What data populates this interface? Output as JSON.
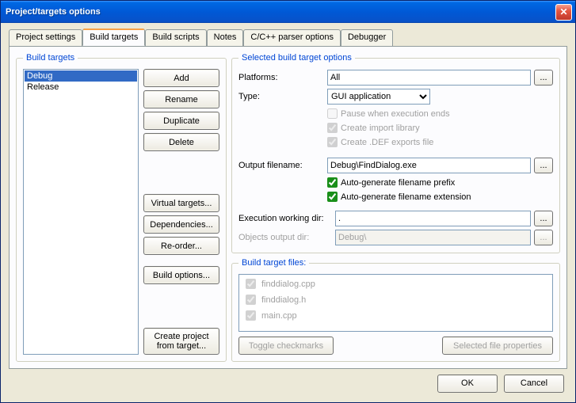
{
  "window": {
    "title": "Project/targets options"
  },
  "tabs": [
    "Project settings",
    "Build targets",
    "Build scripts",
    "Notes",
    "C/C++ parser options",
    "Debugger"
  ],
  "active_tab_index": 1,
  "build_targets": {
    "legend": "Build targets",
    "items": [
      "Debug",
      "Release"
    ],
    "selected_index": 0,
    "buttons": {
      "add": "Add",
      "rename": "Rename",
      "duplicate": "Duplicate",
      "delete": "Delete",
      "virtual": "Virtual targets...",
      "deps": "Dependencies...",
      "reorder": "Re-order...",
      "build_opts": "Build options...",
      "create_from": "Create project\nfrom target..."
    }
  },
  "selected_opts": {
    "legend": "Selected build target options",
    "platforms_label": "Platforms:",
    "platforms_value": "All",
    "type_label": "Type:",
    "type_value": "GUI application",
    "pause": "Pause when execution ends",
    "create_import": "Create import library",
    "create_def": "Create .DEF exports file",
    "output_label": "Output filename:",
    "output_value": "Debug\\FindDialog.exe",
    "auto_prefix": "Auto-generate filename prefix",
    "auto_ext": "Auto-generate filename extension",
    "exec_dir_label": "Execution working dir:",
    "exec_dir_value": ".",
    "obj_dir_label": "Objects output dir:",
    "obj_dir_value": "Debug\\"
  },
  "files": {
    "legend": "Build target files:",
    "items": [
      "finddialog.cpp",
      "finddialog.h",
      "main.cpp"
    ],
    "toggle": "Toggle checkmarks",
    "props": "Selected file properties"
  },
  "footer": {
    "ok": "OK",
    "cancel": "Cancel"
  }
}
